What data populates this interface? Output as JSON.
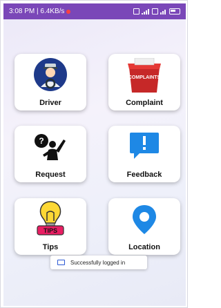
{
  "status_bar": {
    "time_speed": "3:08 PM | 6.4KB/s",
    "right_icons": [
      "sim-icon",
      "signal-icon",
      "wifi-icon",
      "battery-icon"
    ]
  },
  "menu": [
    {
      "label": "Driver",
      "icon": "driver-icon"
    },
    {
      "label": "Complaint",
      "icon": "complaint-box-icon",
      "icon_text": "COMPLAINTS"
    },
    {
      "label": "Request",
      "icon": "request-icon"
    },
    {
      "label": "Feedback",
      "icon": "feedback-icon"
    },
    {
      "label": "Tips",
      "icon": "tips-bulb-icon",
      "icon_text": "TIPS"
    },
    {
      "label": "Location",
      "icon": "location-pin-icon"
    }
  ],
  "toast": {
    "message": "Successfully logged in",
    "icon": "app-icon"
  },
  "colors": {
    "status_bar": "#7a47b8",
    "feedback_blue": "#1e88e5",
    "location_blue": "#1e88e5",
    "complaint_red": "#d32f2f",
    "driver_navy": "#1e3a8a"
  }
}
